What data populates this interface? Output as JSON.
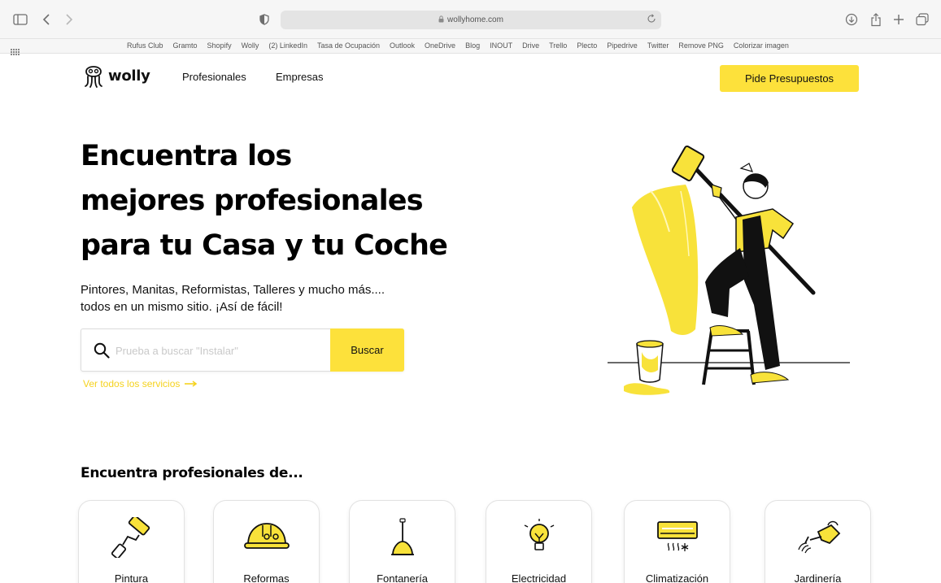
{
  "browser": {
    "url": "wollyhome.com",
    "bookmarks": [
      "Rufus Club",
      "Gramto",
      "Shopify",
      "Wolly",
      "(2) LinkedIn",
      "Tasa de Ocupación",
      "Outlook",
      "OneDrive",
      "Blog",
      "INOUT",
      "Drive",
      "Trello",
      "Plecto",
      "Pipedrive",
      "Twitter",
      "Remove PNG",
      "Colorizar imagen"
    ]
  },
  "header": {
    "logo_text": "wolly",
    "nav": [
      "Profesionales",
      "Empresas"
    ],
    "cta_label": "Pide Presupuestos"
  },
  "hero": {
    "headline": [
      "Encuentra los",
      "mejores profesionales",
      "para tu Casa y tu Coche"
    ],
    "subtext": [
      "Pintores, Manitas, Reformistas, Talleres y mucho más....",
      "todos en un mismo sitio. ¡Así de fácil!"
    ],
    "search": {
      "placeholder": "Prueba a buscar \"Instalar\"",
      "button_label": "Buscar"
    },
    "all_services_link": "Ver todos los servicios"
  },
  "categories": {
    "title": "Encuentra profesionales de...",
    "items": [
      {
        "label": "Pintura",
        "icon": "paint-roller-icon"
      },
      {
        "label": "Reformas",
        "icon": "hard-hat-icon"
      },
      {
        "label": "Fontanería",
        "icon": "plunger-icon"
      },
      {
        "label": "Electricidad",
        "icon": "light-bulb-icon"
      },
      {
        "label": "Climatización",
        "icon": "air-conditioner-icon"
      },
      {
        "label": "Jardinería",
        "icon": "watering-can-icon"
      }
    ]
  },
  "colors": {
    "accent": "#fde13b",
    "link": "#f5d21e",
    "text": "#111111"
  }
}
